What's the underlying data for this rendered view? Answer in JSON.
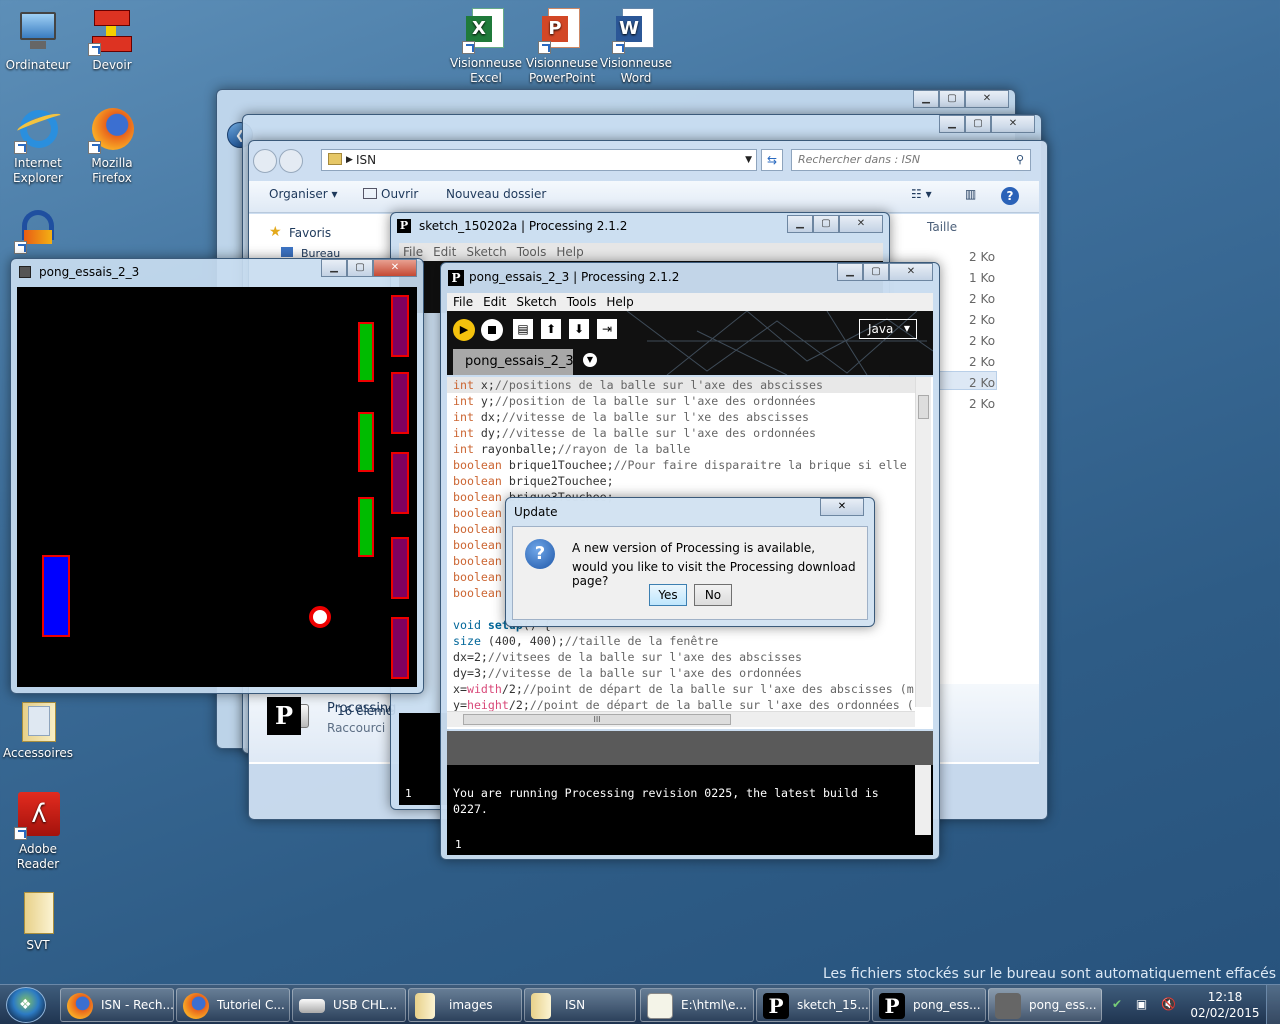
{
  "desktop": {
    "icons": [
      {
        "label": "Ordinateur"
      },
      {
        "label": "Devoir"
      },
      {
        "label": "Internet Explorer"
      },
      {
        "label": "Mozilla Firefox"
      },
      {
        "label": "Accessoires"
      },
      {
        "label": "Adobe Reader"
      },
      {
        "label": "SVT"
      },
      {
        "label": "Visionneuse Excel"
      },
      {
        "label": "Visionneuse PowerPoint"
      },
      {
        "label": "Visionneuse Word"
      }
    ],
    "notice": "Les fichiers stockés sur le bureau sont automatiquement effacés"
  },
  "explorer": {
    "address": "ISN",
    "search_placeholder": "Rechercher dans : ISN",
    "toolbar": {
      "organize": "Organiser",
      "open": "Ouvrir",
      "new_folder": "Nouveau dossier"
    },
    "nav": {
      "favorites": "Favoris",
      "desktop": "Bureau"
    },
    "column_size": "Taille",
    "sizes": [
      "2 Ko",
      "1 Ko",
      "2 Ko",
      "2 Ko",
      "2 Ko",
      "2 Ko",
      "2 Ko",
      "2 Ko"
    ],
    "selected_item": {
      "name": "Processing",
      "type": "Raccourci"
    },
    "status_count": "16 éléme"
  },
  "sketch_window": {
    "title": "sketch_150202a | Processing 2.1.2",
    "menu": [
      "File",
      "Edit",
      "Sketch",
      "Tools",
      "Help"
    ],
    "console_line": "1"
  },
  "pong_window": {
    "title": "pong_essais_2_3"
  },
  "processing": {
    "title": "pong_essais_2_3 | Processing 2.1.2",
    "menu": [
      "File",
      "Edit",
      "Sketch",
      "Tools",
      "Help"
    ],
    "mode": "Java",
    "tab": "pong_essais_2_3",
    "code_top": [
      {
        "kw": "int",
        "rest": " x;",
        "cm": "//positions de la balle sur l'axe des abscisses"
      },
      {
        "kw": "int",
        "rest": " y;",
        "cm": "//position de la balle sur l'axe des ordonnées"
      },
      {
        "kw": "int",
        "rest": " dx;",
        "cm": "//vitesse de la balle sur l'xe des abscisses"
      },
      {
        "kw": "int",
        "rest": " dy;",
        "cm": "//vitesse de la balle sur l'axe des ordonnées"
      },
      {
        "kw": "int",
        "rest": " rayonballe;",
        "cm": "//rayon de la balle"
      },
      {
        "kw": "boolean",
        "rest": " brique1Touchee;",
        "cm": "//Pour faire disparaitre la brique si elle"
      },
      {
        "kw": "boolean",
        "rest": " brique2Touchee;",
        "cm": ""
      },
      {
        "kw": "boolean",
        "rest": " brique3Touchee;",
        "cm": ""
      },
      {
        "kw": "boolean",
        "rest": "",
        "cm": ""
      },
      {
        "kw": "boolean",
        "rest": "",
        "cm": ""
      },
      {
        "kw": "boolean",
        "rest": "",
        "cm": ""
      },
      {
        "kw": "boolean",
        "rest": "",
        "cm": ""
      },
      {
        "kw": "boolean",
        "rest": "",
        "cm": ""
      },
      {
        "kw": "boolean",
        "rest": "",
        "cm": ""
      }
    ],
    "code_bottom": [
      {
        "kw": "void",
        "fn": " setup",
        "rest": "() {",
        "cm": ""
      },
      {
        "kw": "size",
        "fn": "",
        "rest": " (400, 400);",
        "cm": "//taille de la fenêtre"
      },
      {
        "kw": "",
        "fn": "",
        "rest": "dx=2;",
        "cm": "//vitsees de la balle sur l'axe des abscisses"
      },
      {
        "kw": "",
        "fn": "",
        "rest": "dy=3;",
        "cm": "//vitesse de la balle sur l'axe des ordonnées"
      },
      {
        "kw": "",
        "fn": "",
        "rest": "x=",
        "fn2": "width",
        "rest2": "/2;",
        "cm": "//point de départ de la balle sur l'axe des abscisses (m"
      },
      {
        "kw": "",
        "fn": "",
        "rest": "y=",
        "fn2": "height",
        "rest2": "/2;",
        "cm": "//point de départ de la balle sur l'axe des ordonnées ("
      }
    ],
    "console": "You are running Processing revision 0225, the latest build is\n0227.",
    "line_number": "1",
    "scroll_marker": "III"
  },
  "dialog": {
    "title": "Update",
    "line1": "A new version of Processing is available,",
    "line2": "would you like to visit the Processing download page?",
    "yes": "Yes",
    "no": "No"
  },
  "taskbar": {
    "buttons": [
      {
        "label": "ISN - Rech..."
      },
      {
        "label": "Tutoriel C..."
      },
      {
        "label": "USB CHL..."
      },
      {
        "label": "images"
      },
      {
        "label": "ISN"
      },
      {
        "label": "E:\\html\\e..."
      },
      {
        "label": "sketch_15..."
      },
      {
        "label": "pong_ess..."
      },
      {
        "label": "pong_ess..."
      }
    ],
    "time": "12:18",
    "date": "02/02/2015"
  }
}
